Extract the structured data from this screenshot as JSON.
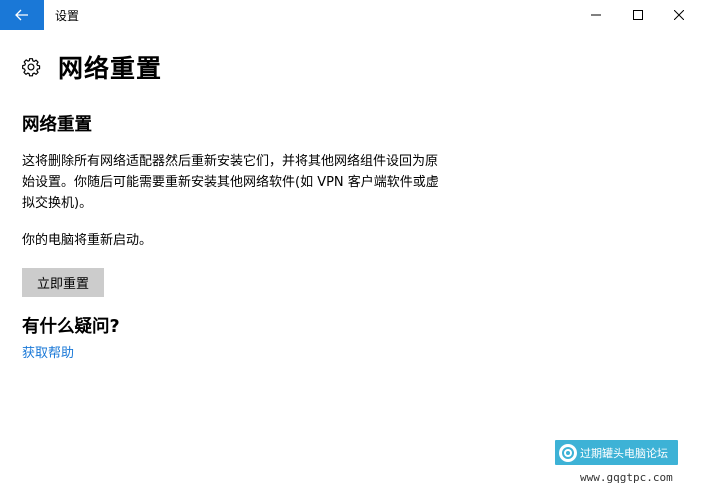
{
  "window": {
    "title": "设置"
  },
  "header": {
    "title": "网络重置",
    "icon": "gear-icon"
  },
  "section": {
    "title": "网络重置",
    "description": "这将删除所有网络适配器然后重新安装它们，并将其他网络组件设回为原始设置。你随后可能需要重新安装其他网络软件(如 VPN 客户端软件或虚拟交换机)。",
    "restart_note": "你的电脑将重新启动。",
    "reset_button": "立即重置"
  },
  "help": {
    "question": "有什么疑问?",
    "link": "获取帮助"
  },
  "watermark": {
    "text": "过期罐头电脑论坛",
    "url": "www.gqgtpc.com"
  },
  "colors": {
    "accent": "#1a78d7",
    "button_bg": "#cccccc",
    "watermark_bg": "#3db2d6"
  }
}
